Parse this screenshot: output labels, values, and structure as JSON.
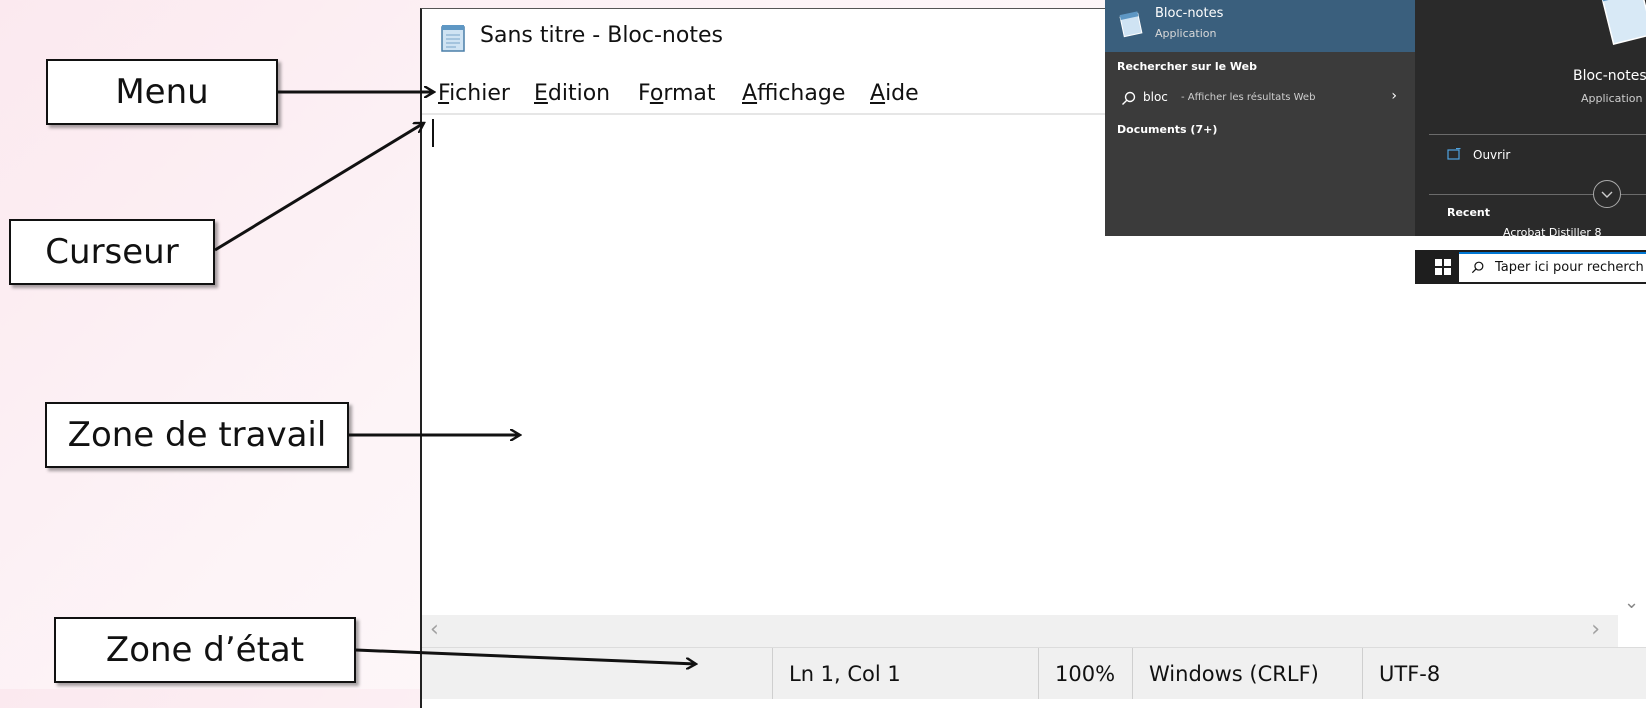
{
  "annotations": {
    "menu": "Menu",
    "cursor": "Curseur",
    "workspace": "Zone de travail",
    "status_zone": "Zone d’état"
  },
  "notepad": {
    "title": "Sans titre - Bloc-notes",
    "menu": [
      {
        "accel": "F",
        "rest": "ichier"
      },
      {
        "accel": "E",
        "rest": "dition"
      },
      {
        "pre": "F",
        "accel": "o",
        "rest": "rmat"
      },
      {
        "accel": "A",
        "rest": "ffichage"
      },
      {
        "accel": "A",
        "rest": "ide"
      }
    ],
    "status": {
      "position": "Ln 1, Col 1",
      "zoom": "100%",
      "line_ending": "Windows (CRLF)",
      "encoding": "UTF-8"
    }
  },
  "search": {
    "best_match_name": "Bloc-notes",
    "best_match_type": "Application",
    "web_header": "Rechercher sur le Web",
    "web_query": "bloc",
    "web_hint": "- Afficher les résultats Web",
    "documents_header": "Documents (7+)"
  },
  "detail": {
    "name": "Bloc-notes",
    "type": "Application",
    "open_label": "Ouvrir",
    "recent_header": "Recent",
    "recent_item": "Acrobat Distiller 8"
  },
  "taskbar": {
    "search_placeholder": "Taper ici pour recherch"
  },
  "colors": {
    "accent": "#0078d4",
    "search_highlight": "#3a5f7d",
    "search_bg": "#3b3b3b",
    "detail_bg": "#2a2a2a"
  },
  "icons": [
    "notepad-icon",
    "search-icon",
    "chevron-right-icon",
    "open-icon",
    "expand-icon",
    "windows-logo-icon",
    "scroll-left-icon",
    "scroll-right-icon",
    "scroll-down-icon"
  ]
}
